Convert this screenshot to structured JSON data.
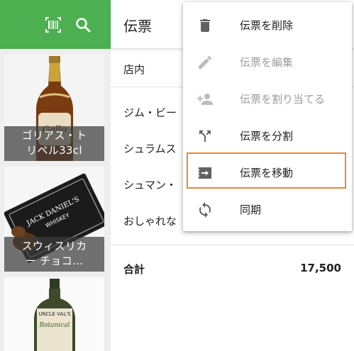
{
  "colors": {
    "accent_green": "#4caf50",
    "highlight_orange": "#e88a35",
    "disabled_text": "#9e9e9e"
  },
  "products": {
    "header_icons": [
      "barcode-icon",
      "search-icon"
    ],
    "tiles": [
      {
        "label": "ゴリアス・ト\nリペル33cl"
      },
      {
        "label": "スウィスリカ\nー チョコ…"
      },
      {
        "label": ""
      }
    ]
  },
  "ticket": {
    "title": "伝票",
    "order_type": "店内",
    "items": [
      "ジム・ビー",
      "シュラムス",
      "シュマン・",
      "おしゃれな"
    ],
    "total_label": "合計",
    "total_value": "17,500"
  },
  "menu": {
    "items": [
      {
        "label": "伝票を削除",
        "icon": "trash-icon",
        "enabled": true
      },
      {
        "label": "伝票を編集",
        "icon": "pencil-icon",
        "enabled": false
      },
      {
        "label": "伝票を割り当てる",
        "icon": "assign-person-icon",
        "enabled": false
      },
      {
        "label": "伝票を分割",
        "icon": "split-icon",
        "enabled": true
      },
      {
        "label": "伝票を移動",
        "icon": "move-ticket-icon",
        "enabled": true
      },
      {
        "label": "同期",
        "icon": "sync-icon",
        "enabled": true
      }
    ]
  }
}
